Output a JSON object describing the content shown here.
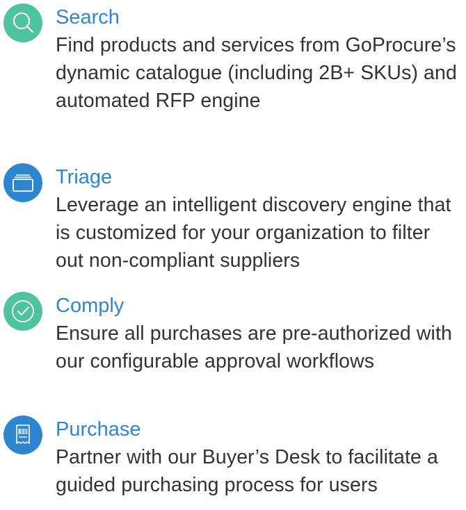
{
  "colors": {
    "search_accent": "#4FC3A0",
    "triage_accent": "#2E86D1",
    "comply_accent": "#4FC3A0",
    "purchase_accent": "#2E86D1",
    "body_text": "#333333"
  },
  "features": [
    {
      "icon": "search-icon",
      "title": "Search",
      "description": "Find products and services from GoProcure’s dynamic catalogue (including 2B+ SKUs) and automated RFP engine"
    },
    {
      "icon": "folder-stack-icon",
      "title": "Triage",
      "description": "Leverage an intelligent discovery engine that is customized for your organization to filter out non-compliant suppliers"
    },
    {
      "icon": "checkmark-circle-icon",
      "title": "Comply",
      "description": "Ensure all purchases are pre-authorized with our configurable approval workflows"
    },
    {
      "icon": "receipt-icon",
      "title": "Purchase",
      "description": "Partner with our Buyer’s Desk to facilitate a guided purchasing process for users"
    }
  ]
}
